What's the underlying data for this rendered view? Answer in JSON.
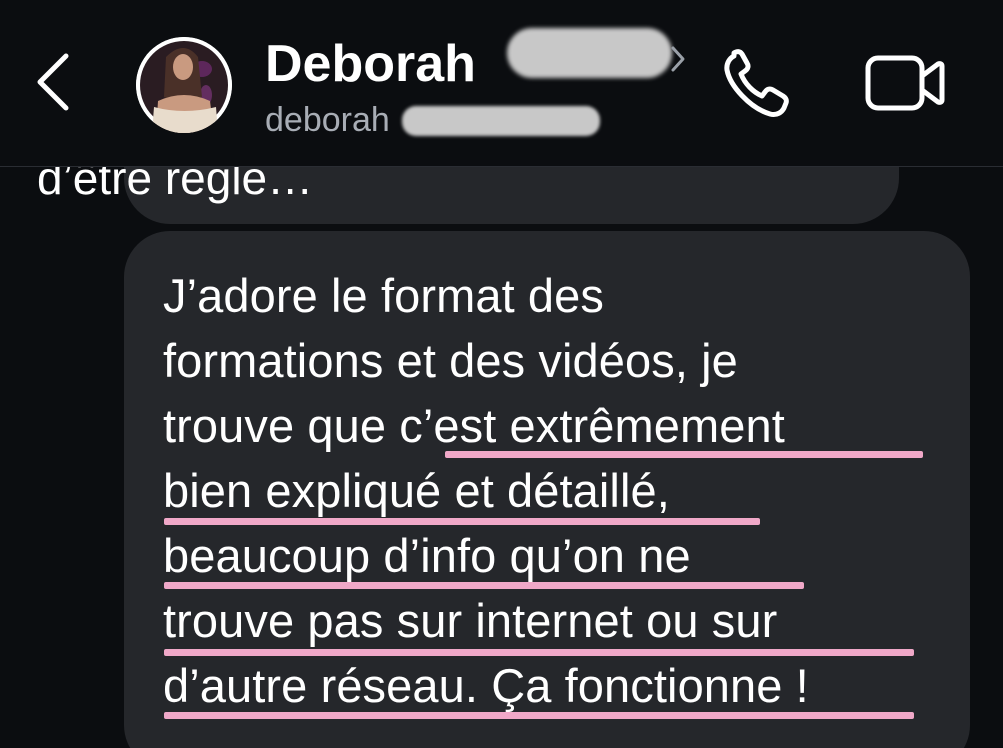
{
  "header": {
    "contact_name": "Deborah",
    "contact_handle": "deborah",
    "back_icon": "chevron-left-icon",
    "call_icon": "phone-icon",
    "video_icon": "video-camera-icon"
  },
  "messages": {
    "previous_fragment": "d’être réglé…",
    "main_lines": [
      "J’adore le format des",
      "formations et des vidéos, je",
      "trouve que c’est extrêmement",
      "bien expliqué et détaillé,",
      "beaucoup d’info qu’on ne",
      "trouve pas sur internet ou sur",
      "d’autre réseau. Ça fonctionne !"
    ]
  },
  "colors": {
    "background": "#0b0d10",
    "bubble": "#25272b",
    "text": "#ffffff",
    "handle_text": "#a8adb5",
    "highlight_underline": "#f0a8c8"
  }
}
